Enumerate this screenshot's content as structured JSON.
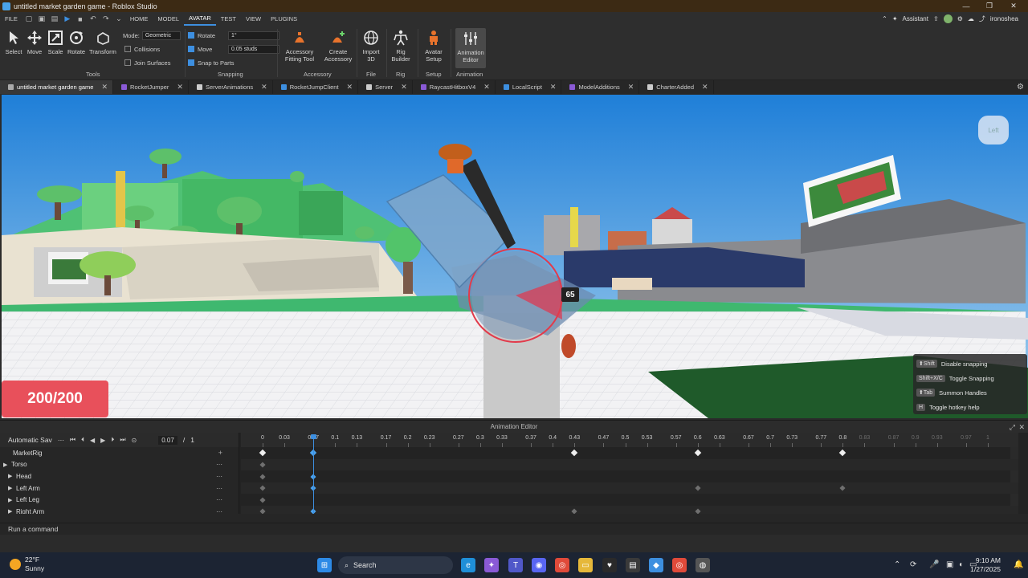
{
  "window": {
    "title": "untitled market garden game - Roblox Studio",
    "minimize": "—",
    "maximize": "❐",
    "close": "✕"
  },
  "menubar": {
    "items": [
      "FILE",
      "HOME",
      "MODEL",
      "AVATAR",
      "TEST",
      "VIEW",
      "PLUGINS"
    ],
    "active": "AVATAR",
    "assistant": "Assistant",
    "username": "ironoshea"
  },
  "ribbon": {
    "tools": {
      "select": "Select",
      "move": "Move",
      "scale": "Scale",
      "rotate": "Rotate",
      "transform": "Transform",
      "group_label": "Tools"
    },
    "mode": {
      "label": "Mode:",
      "value": "Geometric"
    },
    "collisions": "Collisions",
    "join_surfaces": "Join Surfaces",
    "snapping": {
      "rotate_label": "Rotate",
      "rotate_value": "1°",
      "move_label": "Move",
      "move_value": "0.05 studs",
      "snap_to_parts": "Snap to Parts",
      "group_label": "Snapping"
    },
    "accessory": {
      "fitting_tool": "Accessory Fitting Tool",
      "create": "Create Accessory",
      "group_label": "Accessory"
    },
    "file": {
      "import3d": "Import 3D",
      "group_label": "File"
    },
    "rig": {
      "rig_builder": "Rig Builder",
      "group_label": "Rig"
    },
    "setup": {
      "avatar_setup": "Avatar Setup",
      "group_label": "Setup"
    },
    "animation": {
      "editor": "Animation Editor",
      "group_label": "Animation"
    }
  },
  "tabs": [
    {
      "label": "untitled market garden game",
      "color": "#aaaaaa",
      "active": true
    },
    {
      "label": "RocketJumper",
      "color": "#8a5ad6"
    },
    {
      "label": "ServerAnimations",
      "color": "#cccccc"
    },
    {
      "label": "RocketJumpClient",
      "color": "#3d8fe0"
    },
    {
      "label": "Server",
      "color": "#cccccc"
    },
    {
      "label": "RaycastHitboxV4",
      "color": "#8a5ad6"
    },
    {
      "label": "LocalScript",
      "color": "#3d8fe0"
    },
    {
      "label": "ModelAdditions",
      "color": "#8a5ad6"
    },
    {
      "label": "CharterAdded",
      "color": "#cccccc"
    }
  ],
  "viewport": {
    "health": "200/200",
    "rotation_value": "65",
    "view_cube": "Left",
    "hotkeys": [
      {
        "key": "⬆Shift",
        "desc": "Disable snapping"
      },
      {
        "key": "Shift+X/C",
        "desc": "Toggle Snapping"
      },
      {
        "key": "⬆Tab",
        "desc": "Summon Handles"
      },
      {
        "key": "H",
        "desc": "Toggle hotkey help"
      }
    ]
  },
  "animation_editor": {
    "title": "Animation Editor",
    "anim_name": "Automatic Sav",
    "current_time": "0.07",
    "length": "1",
    "tracks": [
      {
        "name": "MarketRig",
        "expanded": false,
        "arrow": ""
      },
      {
        "name": "Torso",
        "arrow": "▶"
      },
      {
        "name": "Head",
        "arrow": "▶"
      },
      {
        "name": "Left Arm",
        "arrow": "▶"
      },
      {
        "name": "Left Leg",
        "arrow": "▶"
      },
      {
        "name": "Right Arm",
        "arrow": "▶"
      }
    ],
    "ticks": [
      "0",
      "0.03",
      "0.07",
      "0.1",
      "0.13",
      "0.17",
      "0.2",
      "0.23",
      "0.27",
      "0.3",
      "0.33",
      "0.37",
      "0.4",
      "0.43",
      "0.47",
      "0.5",
      "0.53",
      "0.57",
      "0.6",
      "0.63",
      "0.67",
      "0.7",
      "0.73",
      "0.77",
      "0.8",
      "0.83",
      "0.87",
      "0.9",
      "0.93",
      "0.97",
      "1"
    ],
    "keyframes": {
      "root": [
        0,
        0.07,
        0.43,
        0.6,
        0.8
      ],
      "torso": [
        0
      ],
      "head": [
        0,
        0.07
      ],
      "left_arm": [
        0,
        0.07,
        0.6,
        0.8
      ],
      "left_leg": [
        0
      ],
      "right_arm": [
        0,
        0.07,
        0.43,
        0.6
      ]
    }
  },
  "command_bar": {
    "placeholder": "Run a command"
  },
  "taskbar": {
    "weather_temp": "22°F",
    "weather_desc": "Sunny",
    "search": "Search",
    "time": "9:10 AM",
    "date": "1/27/2025"
  }
}
